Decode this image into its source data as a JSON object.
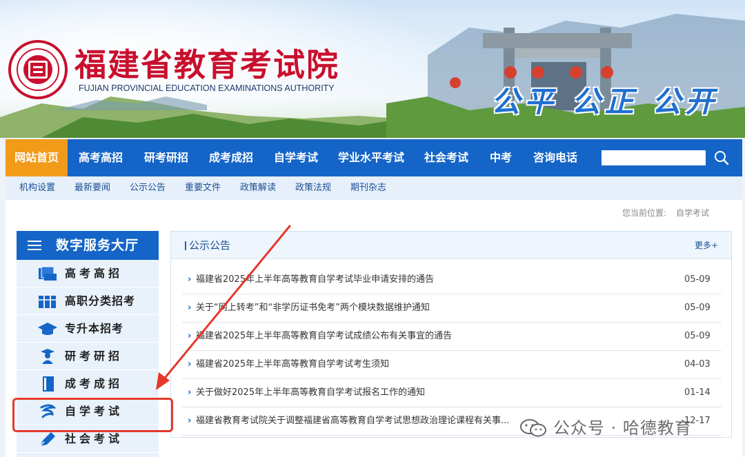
{
  "banner": {
    "title": "福建省教育考试院",
    "subtitle": "FUJIAN PROVINCIAL EDUCATION EXAMINATIONS AUTHORITY",
    "slogan": "公平 公正 公开"
  },
  "nav": {
    "items": [
      "网站首页",
      "高考高招",
      "研考研招",
      "成考成招",
      "自学考试",
      "学业水平考试",
      "社会考试",
      "中考",
      "咨询电话"
    ],
    "active_index": 0,
    "search_placeholder": ""
  },
  "subnav": {
    "items": [
      "机构设置",
      "最新要闻",
      "公示公告",
      "重要文件",
      "政策解读",
      "政策法规",
      "期刊杂志"
    ]
  },
  "breadcrumb": {
    "label": "您当前位置:",
    "current": "自学考试"
  },
  "sidebar": {
    "title": "数字服务大厅",
    "items": [
      {
        "label": "高考高招",
        "icon": "book-stack-icon"
      },
      {
        "label": "高职分类招考",
        "icon": "books-icon"
      },
      {
        "label": "专升本招考",
        "icon": "graduation-cap-icon"
      },
      {
        "label": "研考研招",
        "icon": "graduate-person-icon"
      },
      {
        "label": "成考成招",
        "icon": "notebook-icon"
      },
      {
        "label": "自学考试",
        "icon": "self-study-icon"
      },
      {
        "label": "社会考试",
        "icon": "pen-icon"
      }
    ]
  },
  "notices": {
    "title": "公示公告",
    "more": "更多+",
    "items": [
      {
        "title": "福建省2025年上半年高等教育自学考试毕业申请安排的通告",
        "date": "05-09"
      },
      {
        "title": "关于“网上转考”和“非学历证书免考”两个模块数据维护通知",
        "date": "05-09"
      },
      {
        "title": "福建省2025年上半年高等教育自学考试成绩公布有关事宜的通告",
        "date": "05-09"
      },
      {
        "title": "福建省2025年上半年高等教育自学考试考生须知",
        "date": "04-03"
      },
      {
        "title": "关于做好2025年上半年高等教育自学考试报名工作的通知",
        "date": "01-14"
      },
      {
        "title": "福建省教育考试院关于调整福建省高等教育自学考试思想政治理论课程有关事...",
        "date": "12-17"
      }
    ]
  },
  "watermark": {
    "text": "公众号 · 哈德教育"
  },
  "colors": {
    "primary": "#1565c8",
    "active_tab": "#f29b19",
    "brand_red": "#c8102e",
    "highlight": "#e5382b"
  }
}
